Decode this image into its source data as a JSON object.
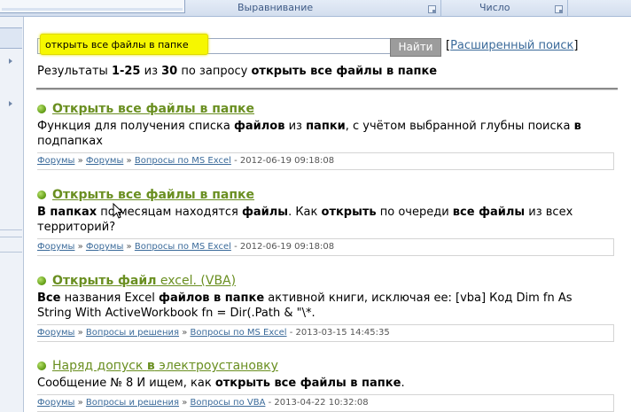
{
  "ribbon": {
    "group_align": "Выравнивание",
    "group_number": "Число"
  },
  "search": {
    "query": "открыть все файлы в папке",
    "button": "Найти",
    "advanced_prefix": "[",
    "advanced_link": "Расширенный поиск",
    "advanced_suffix": "]"
  },
  "summary": {
    "prefix": "Результаты ",
    "range": "1-25",
    "of": " из ",
    "total": "30",
    "by": " по запросу ",
    "query": "открыть все файлы в папке"
  },
  "results": [
    {
      "title": "Открыть все файлы в папке",
      "desc": [
        {
          "t": "Функция для получения списка ",
          "b": false
        },
        {
          "t": "файлов",
          "b": true
        },
        {
          "t": " из ",
          "b": false
        },
        {
          "t": "папки",
          "b": true
        },
        {
          "t": ", с учётом выбранной глубны поиска ",
          "b": false
        },
        {
          "t": "в",
          "b": true
        },
        {
          "t": " подпапках",
          "b": false
        }
      ],
      "crumbs": [
        "Форумы",
        "Форумы",
        "Вопросы по MS Excel"
      ],
      "date": "2012-06-19 09:18:08"
    },
    {
      "title": "Открыть все файлы в папке",
      "desc": [
        {
          "t": "В папках",
          "b": true
        },
        {
          "t": " по месяцам находятся ",
          "b": false
        },
        {
          "t": "файлы",
          "b": true
        },
        {
          "t": ". Как ",
          "b": false
        },
        {
          "t": "открыть",
          "b": true
        },
        {
          "t": " по очереди ",
          "b": false
        },
        {
          "t": "все файлы",
          "b": true
        },
        {
          "t": " из всех территорий?",
          "b": false
        }
      ],
      "crumbs": [
        "Форумы",
        "Форумы",
        "Вопросы по MS Excel"
      ],
      "date": "2012-06-19 09:18:08"
    },
    {
      "title_bold": "Открыть файл",
      "title_rest": " excel. (VBA)",
      "desc": [
        {
          "t": "Все",
          "b": true
        },
        {
          "t": " названия Excel ",
          "b": false
        },
        {
          "t": "файлов в папке",
          "b": true
        },
        {
          "t": " активной книги, исключая ее: [vba] Код Dim fn As String With ActiveWorkbook fn = Dir(.Path & \"\\*.",
          "b": false
        }
      ],
      "crumbs": [
        "Форумы",
        "Вопросы и решения",
        "Вопросы по MS Excel"
      ],
      "date": "2013-03-15 14:45:35"
    },
    {
      "title_pre": "Наряд допуск ",
      "title_bold": "в",
      "title_post": " электроустановку",
      "desc": [
        {
          "t": "Сообщение № 8 И ищем, как ",
          "b": false
        },
        {
          "t": "открыть все файлы в папке",
          "b": true
        },
        {
          "t": ".",
          "b": false
        }
      ],
      "crumbs": [
        "Форумы",
        "Вопросы и решения",
        "Вопросы по VBA"
      ],
      "date": "2013-04-22 10:32:08"
    }
  ]
}
